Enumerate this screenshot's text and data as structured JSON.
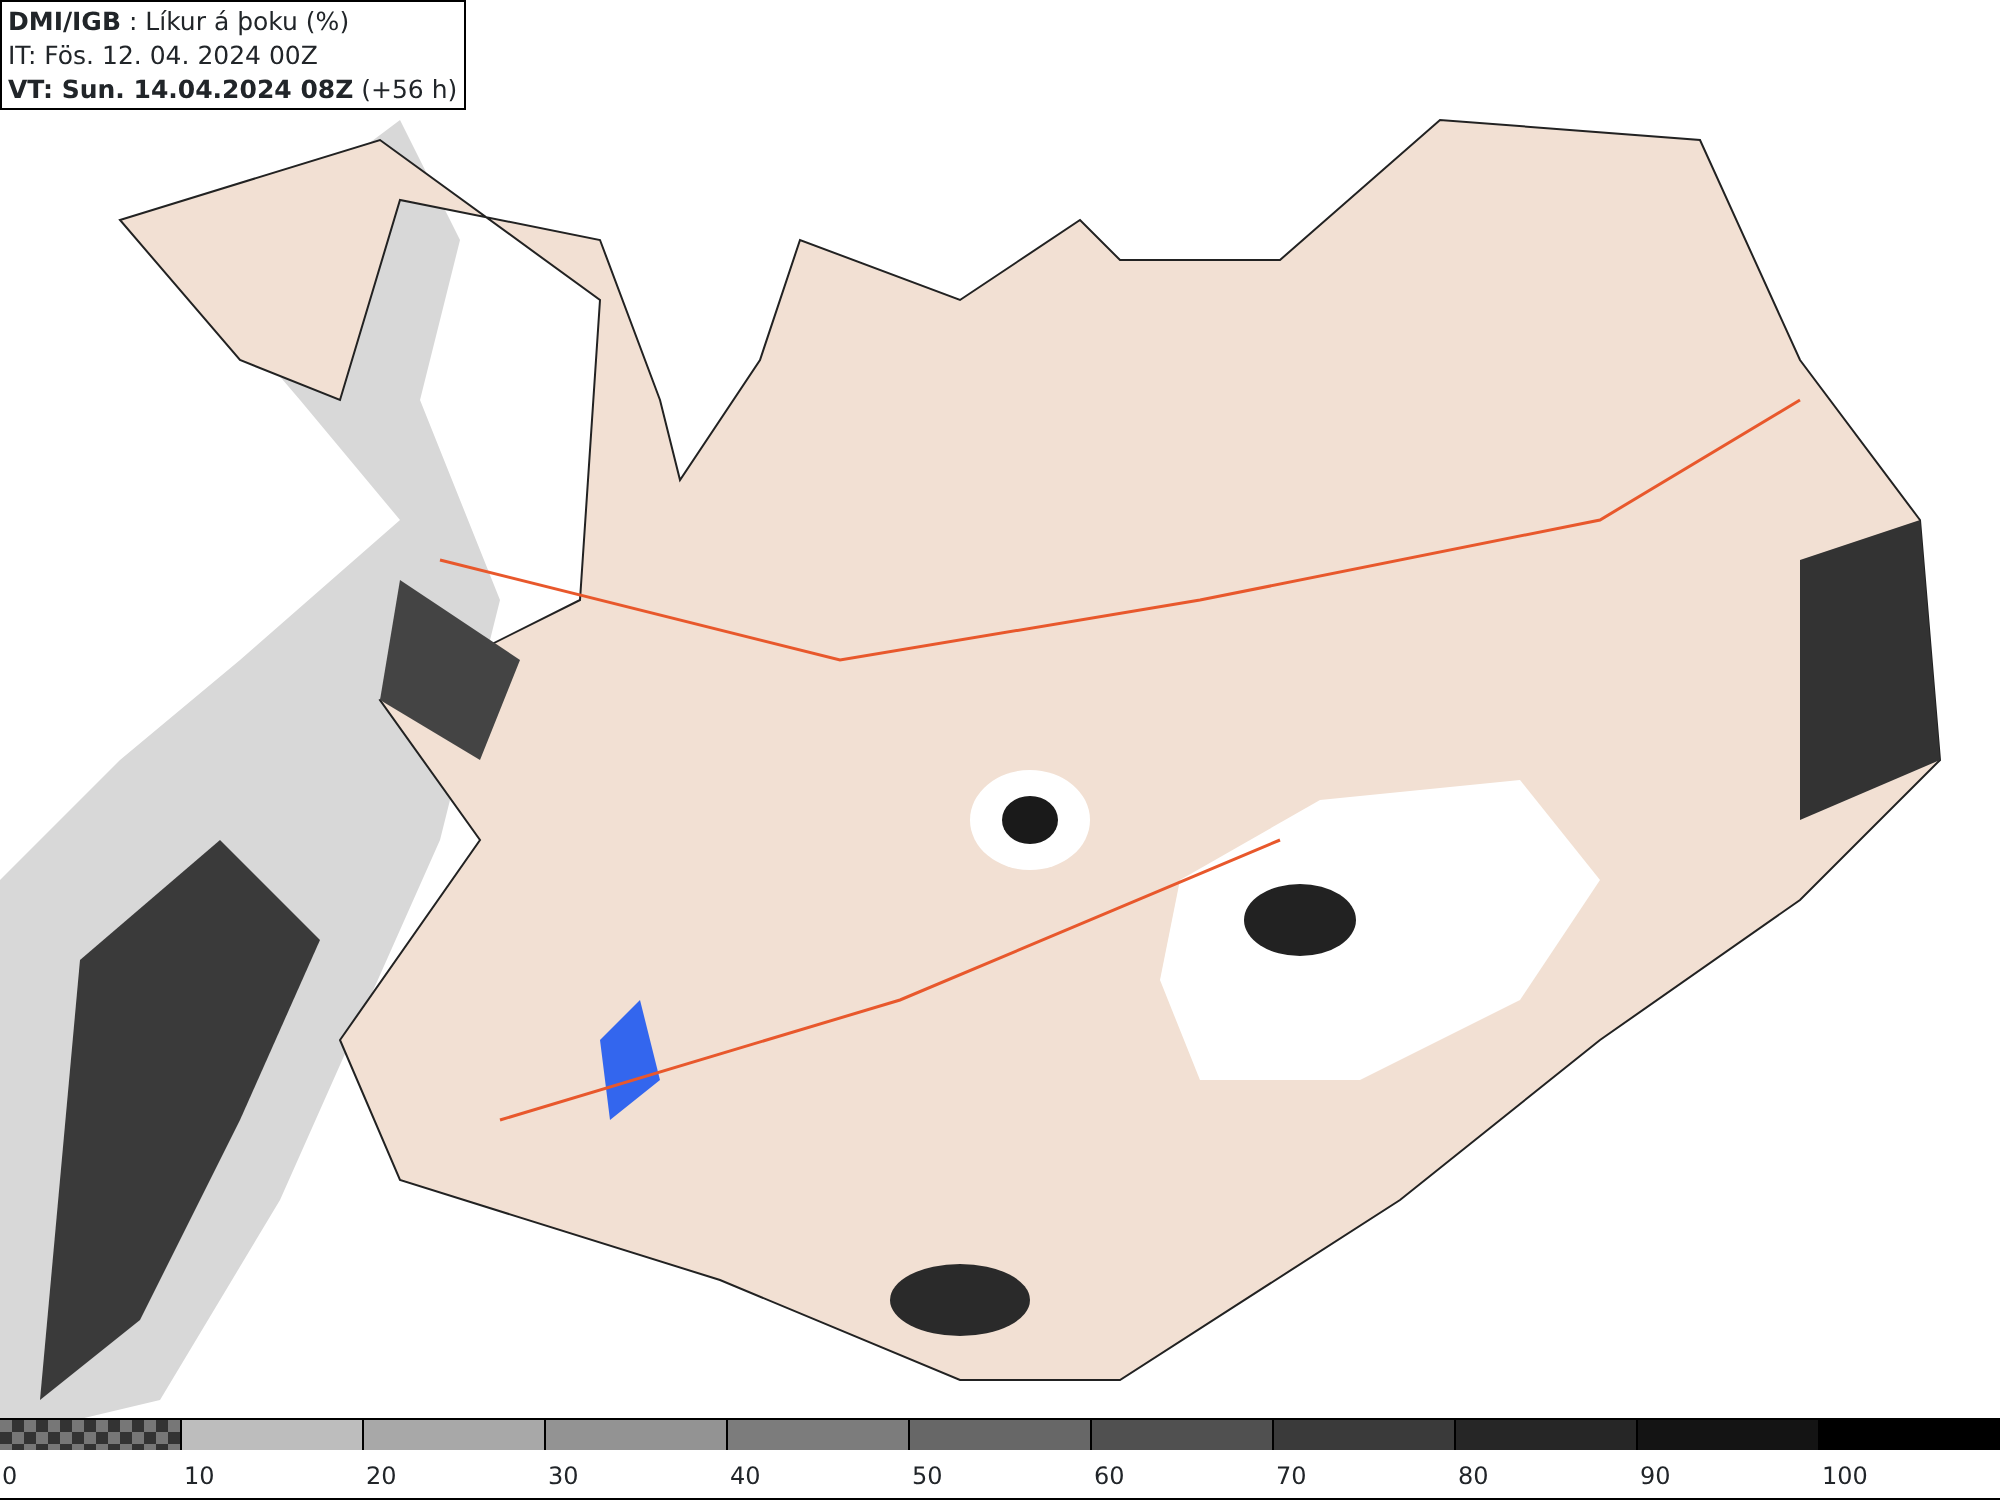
{
  "header": {
    "lines": [
      "**DMI/IGB** : Líkur á þoku (%)",
      "IT: Fös. 12. 04. 2024 00Z",
      "**VT: Sun. 14.04.2024 08Z** (+56 h)"
    ]
  },
  "legend": [
    {
      "label": "0",
      "kind": "checker"
    },
    {
      "label": "10",
      "kind": "solid",
      "color": "#bdbdbd"
    },
    {
      "label": "20",
      "kind": "solid",
      "color": "#a8a8a8"
    },
    {
      "label": "30",
      "kind": "solid",
      "color": "#939393"
    },
    {
      "label": "40",
      "kind": "solid",
      "color": "#7c7c7c"
    },
    {
      "label": "50",
      "kind": "solid",
      "color": "#676767"
    },
    {
      "label": "60",
      "kind": "solid",
      "color": "#505050"
    },
    {
      "label": "70",
      "kind": "solid",
      "color": "#3a3a3a"
    },
    {
      "label": "80",
      "kind": "solid",
      "color": "#262626"
    },
    {
      "label": "90",
      "kind": "solid",
      "color": "#141414"
    },
    {
      "label": "100",
      "kind": "solid",
      "color": "#000000"
    }
  ]
}
